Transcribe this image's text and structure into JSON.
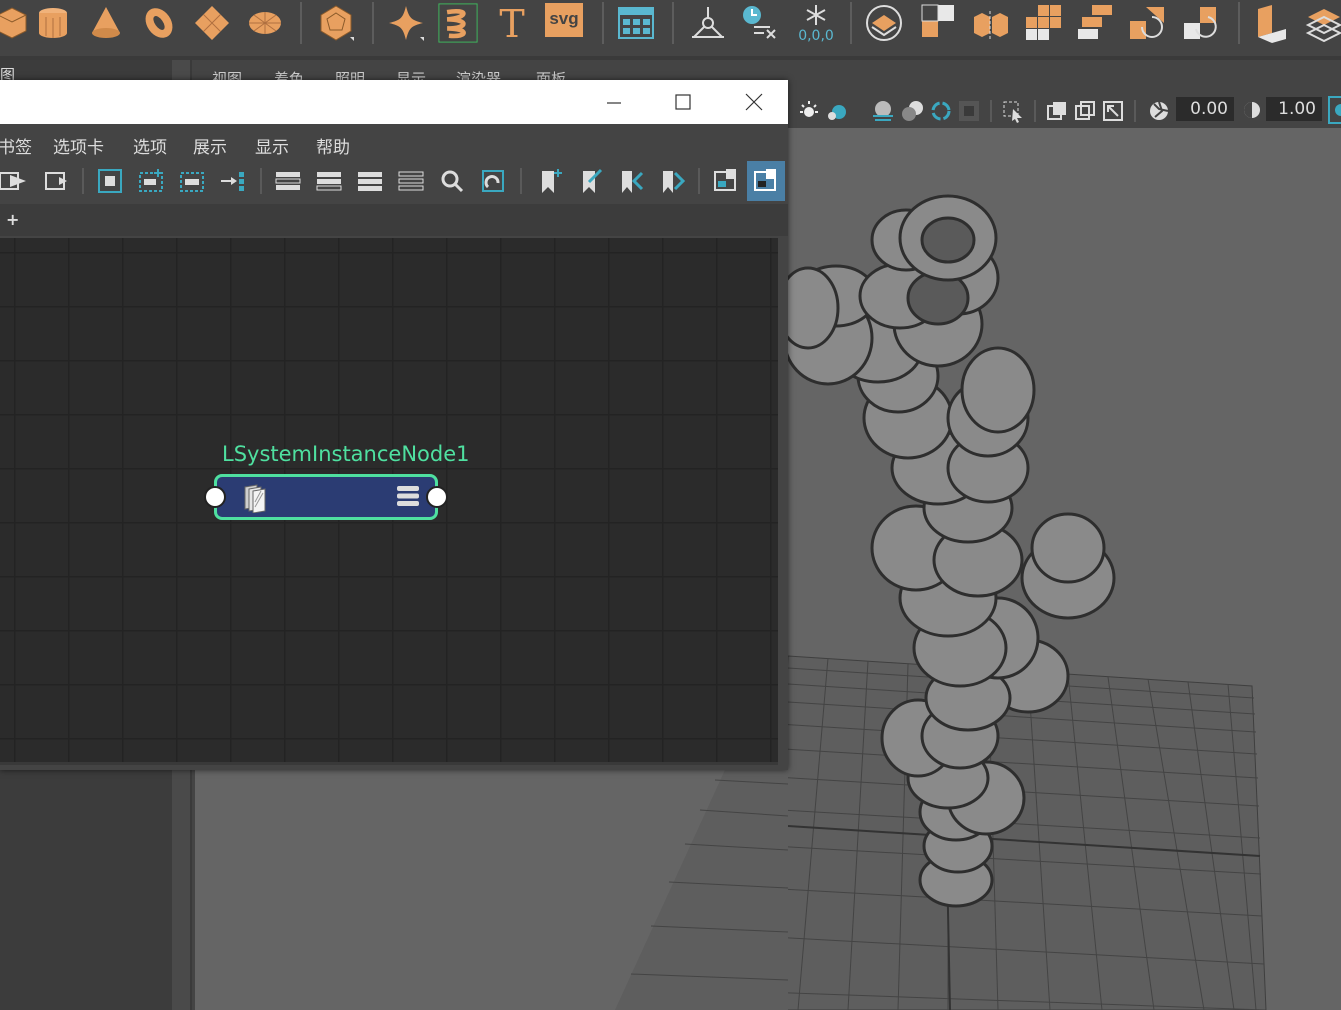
{
  "shelf": {
    "icons": [
      "cube-icon",
      "cylinder-icon",
      "cone-icon",
      "torus-icon",
      "plane-icon",
      "disc-icon",
      "polyhedron-icon",
      "super-shape-icon",
      "helix-icon",
      "text-icon",
      "svg-icon",
      "type-grid-icon",
      "mirror-icon",
      "freeze-transforms-icon",
      "snowflake-icon",
      "shading-icon",
      "split-icon",
      "extract-icon",
      "smooth-icon",
      "subdivide-icon",
      "boolean-union-icon",
      "boolean-diff-icon",
      "bevel-icon",
      "extrude-icon"
    ],
    "svg_label": "svg",
    "text_label": "T",
    "freeze_values": "0,0,0"
  },
  "left_panel": {
    "tab_label": "图"
  },
  "viewport": {
    "menus": [
      "视图",
      "着色",
      "照明",
      "显示",
      "渲染器",
      "面板"
    ],
    "exposure": "0.00",
    "gamma": "1.00"
  },
  "node_editor": {
    "menus": [
      "书签",
      "选项卡",
      "选项",
      "展示",
      "显示",
      "帮助"
    ],
    "add_tab_label": "+",
    "node": {
      "name": "LSystemInstanceNode1"
    }
  },
  "colors": {
    "shelf_icon": "#e8a060",
    "node_border": "#4fe0a0",
    "node_fill": "#2b3c73",
    "graph_bg": "#2b2b2b",
    "viewport_bg": "#656565"
  }
}
